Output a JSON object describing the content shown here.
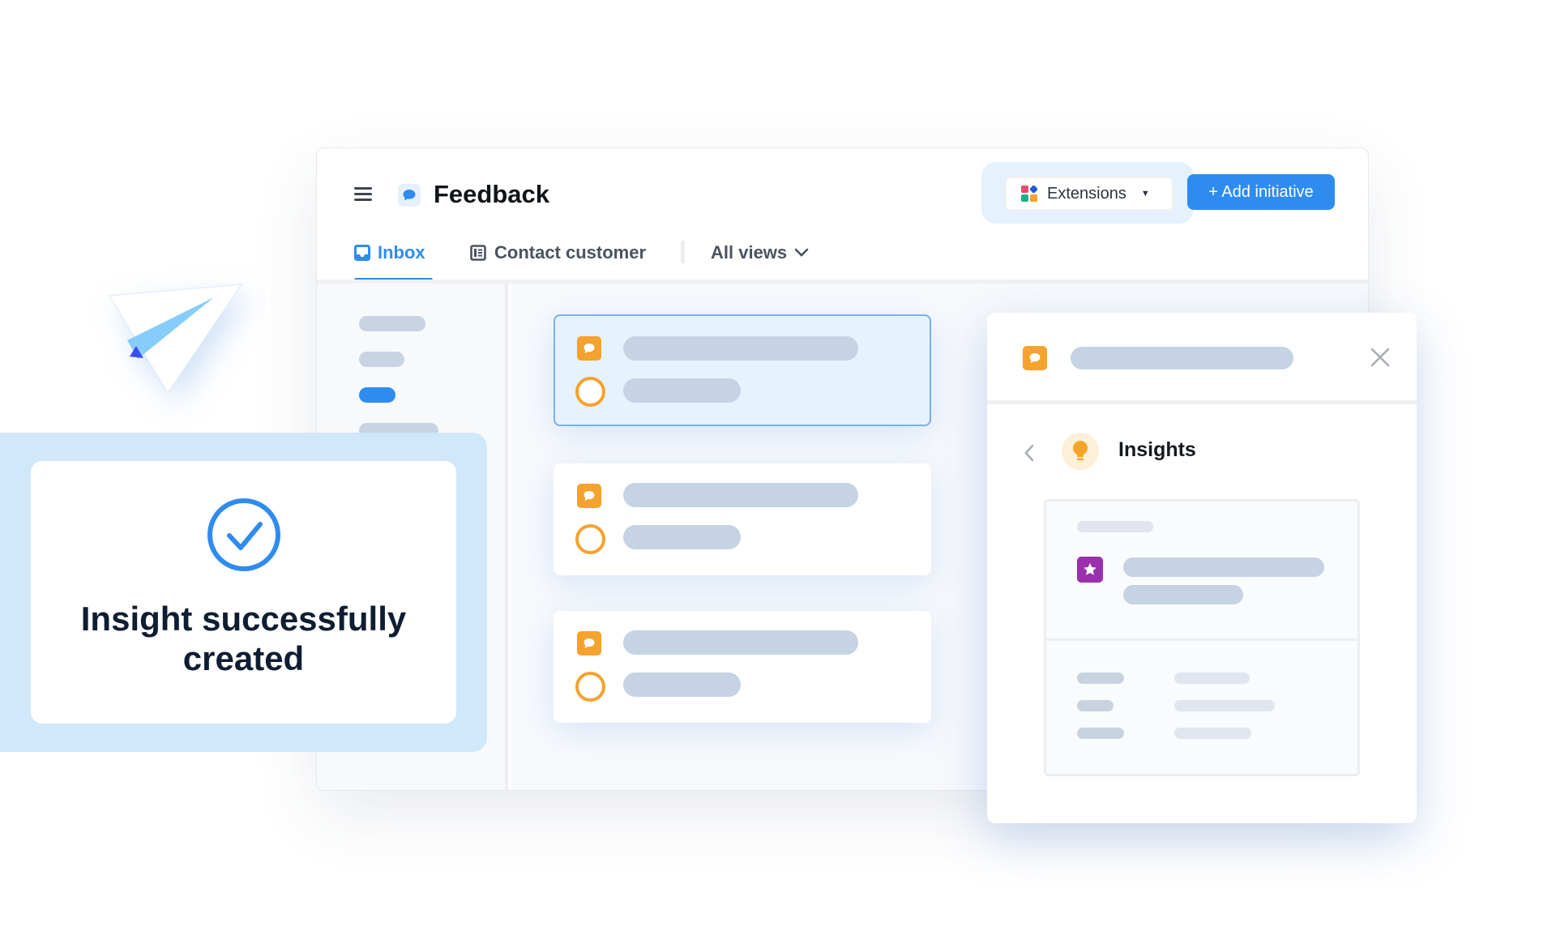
{
  "header": {
    "title": "Feedback",
    "extensions_label": "Extensions",
    "add_initiative_label": "+ Add initiative"
  },
  "tabs": [
    {
      "label": "Inbox",
      "icon": "inbox-icon",
      "active": true
    },
    {
      "label": "Contact customer",
      "icon": "layout-icon",
      "active": false
    }
  ],
  "views_dropdown": {
    "label": "All views"
  },
  "panel": {
    "title": "Insights"
  },
  "toast": {
    "message": "Insight successfully created"
  },
  "colors": {
    "accent": "#2e8cf0",
    "feedback_orange": "#f5a22e",
    "insight_purple": "#9b2fae",
    "skeleton": "#c6d3e4",
    "toast_bg": "#cfe6fa"
  }
}
